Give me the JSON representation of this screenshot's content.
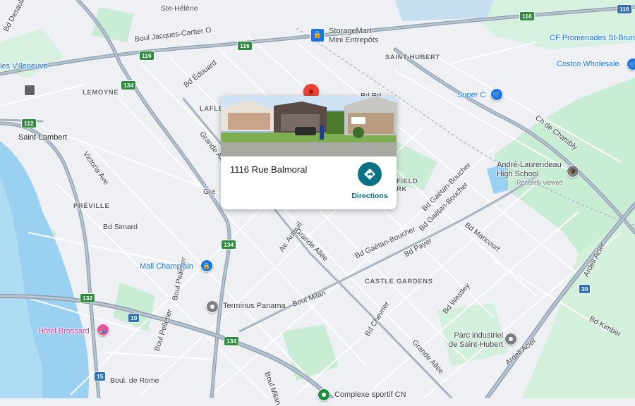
{
  "map": {
    "colors": {
      "land": "#eef0f3",
      "water": "#9ad1f0",
      "park": "#c8ecd4",
      "road_major": "#9aa7b4",
      "road_minor": "#ffffff",
      "marker": "#ea4335",
      "accent": "#0b7285"
    },
    "roads_labels": {
      "boul_jacques_cartier": "Boul Jacques-Cartier O",
      "bd_edouard": "Bd Édouard",
      "grande_allee_1": "Grande Allée",
      "grande_allee_2": "Grande Allée",
      "grande_allee_3": "Grande Allée",
      "victoria_ave": "Victoria Ave",
      "bd_simard": "Bd Simard",
      "av_auteuil": "Av. Auteuil",
      "bd_gaetan_boucher_1": "Bd Gaétan-Boucher",
      "bd_gaetan_boucher_2": "Bd Gaétan-Boucher",
      "bd_gaetan_boucher_3": "Bd Gaétan-Boucher",
      "bd_payer": "Bd Payer",
      "bd_maricourt": "Bd Maricourt",
      "ch_de_chambly": "Ch de Chambly",
      "boul_milan_1": "Boul Milan",
      "boul_milan_2": "Boul Milan",
      "bd_chevrier": "Bd Chevrier",
      "bd_westley": "Bd Westley",
      "bd_kimber": "Bd Kimber",
      "ardell_acier_1": "Ardell Acier",
      "ardell_acier_2": "Ardell Acier",
      "boul_pelletier_1": "Boul Pelletier",
      "boul_pelletier_2": "Boul Pelletier",
      "boul_de_rome": "Boul. de Rome",
      "bd_desaulniers": "Bd Desaulniers",
      "ste_helene": "Ste-Hélène",
      "bd_rd": "Bd Rd",
      "gre": "Gre"
    },
    "area_labels": {
      "saint_hubert": "SAINT-HUBERT",
      "lemoyne": "LEMOYNE",
      "laflèche": "LAFLE",
      "saint_lambert": "Saint-Lambert",
      "preville": "PRÉVILLE",
      "castle_gardens": "CASTLE GARDENS",
      "field_rk": "FIELD\nRK",
      "les_villeneuve": "les Villeneuve"
    },
    "pois": {
      "storagemart": "StorageMart\nMini Entrepôts",
      "cf_promenades": "CF Promenades St-Brun",
      "costco": "Costco Wholesale",
      "super_c": "Super C",
      "andre_laurendeau": "André-Laurendeau\nHigh School",
      "recently_viewed": "Recently viewed",
      "mall_champlain": "Mall Champlain",
      "terminus_panama": "Terminus Panama",
      "hotel_brossard": "Hôtel Brossard",
      "parc_industriel": "Parc industriel\nde Saint-Hubert",
      "complexe_sportif": "Complexe sportif CN"
    },
    "shields": {
      "r116_a": "116",
      "r116_b": "116",
      "r116_c": "116",
      "r116_d": "116",
      "r134_a": "134",
      "r134_b": "134",
      "r134_c": "134",
      "r112": "112",
      "r132": "132",
      "r10": "10",
      "r15": "15",
      "r30": "30"
    }
  },
  "popup": {
    "address": "1116 Rue Balmoral",
    "directions_label": "Directions"
  }
}
